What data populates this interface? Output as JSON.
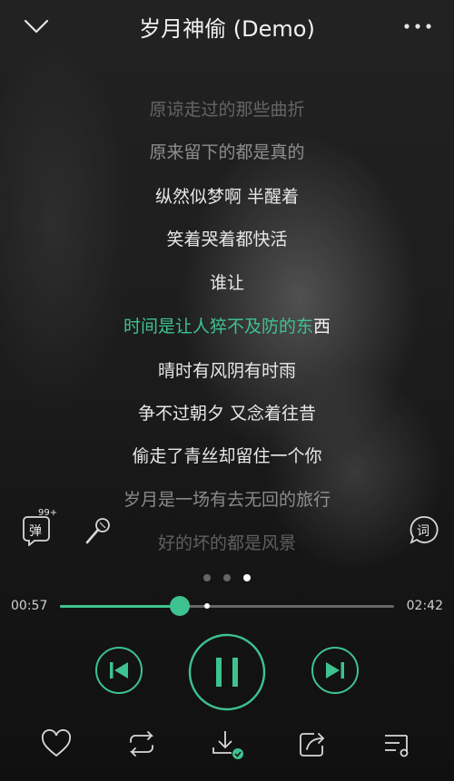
{
  "header": {
    "title": "岁月神偷 (Demo)",
    "back_icon": "chevron-down-icon",
    "more_icon": "more-dots-icon"
  },
  "lyrics": {
    "lines": [
      "原谅走过的那些曲折",
      "原来留下的都是真的",
      "纵然似梦啊 半醒着",
      "笑着哭着都快活",
      "谁让",
      "",
      "晴时有风阴有时雨",
      "争不过朝夕 又念着往昔",
      "偷走了青丝却留住一个你",
      "岁月是一场有去无回的旅行",
      "好的坏的都是风景"
    ],
    "current_sung": "时间是让人猝不及防的东",
    "current_rest": "西",
    "highlight_color": "#3ec28f"
  },
  "side": {
    "danmaku_label": "弹",
    "danmaku_count": "99+",
    "mic_icon": "microphone-icon",
    "lyric_icon_label": "词"
  },
  "pager": {
    "pages": 3,
    "active": 3
  },
  "player": {
    "elapsed": "00:57",
    "duration": "02:42",
    "progress": 0.36,
    "buffered": 0.44,
    "accent": "#3ec28f"
  },
  "controls": {
    "prev_icon": "skip-previous-icon",
    "play_pause_icon": "pause-icon",
    "next_icon": "skip-next-icon"
  },
  "bottom_bar": {
    "icons": [
      "heart-icon",
      "repeat-icon",
      "download-done-icon",
      "share-icon",
      "playlist-icon"
    ]
  }
}
